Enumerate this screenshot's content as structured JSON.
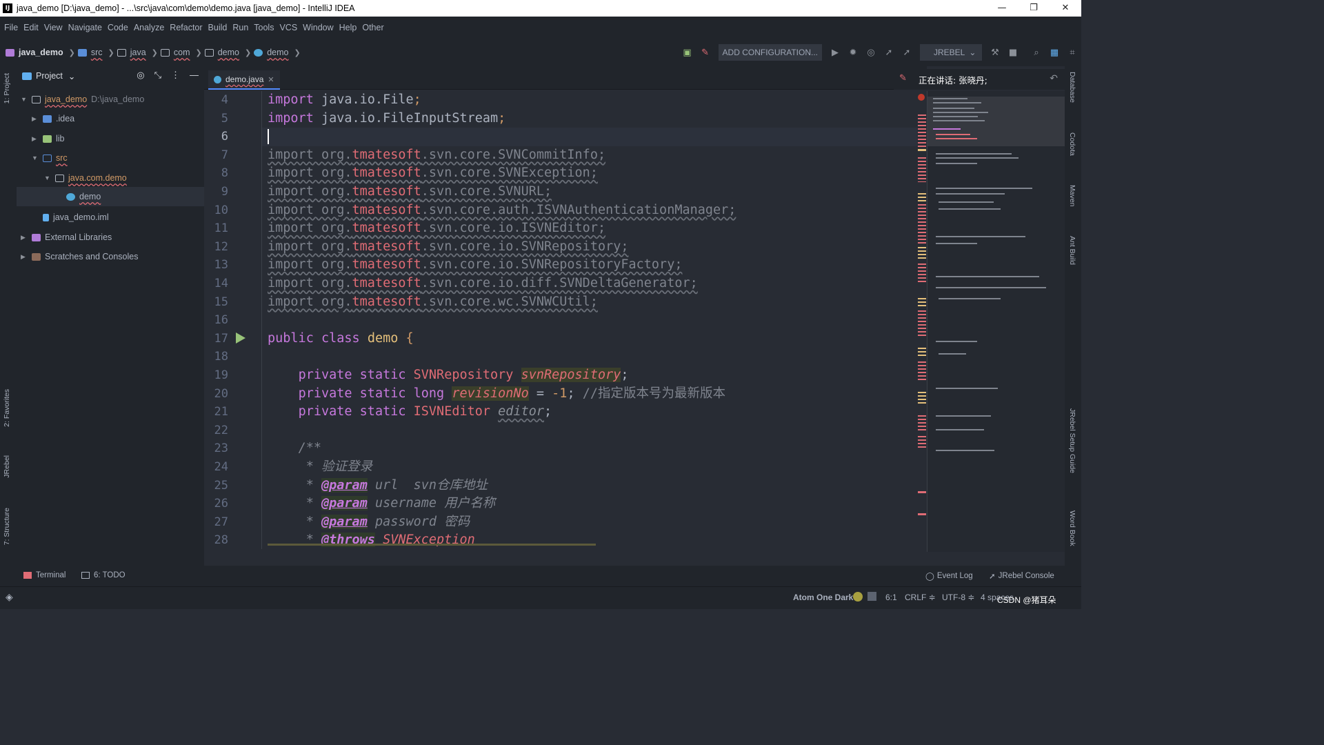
{
  "window": {
    "title": "java_demo [D:\\java_demo] - ...\\src\\java\\com\\demo\\demo.java [java_demo] - IntelliJ IDEA",
    "minimize": "—",
    "maximize": "❐",
    "close": "✕"
  },
  "menu": [
    "File",
    "Edit",
    "View",
    "Navigate",
    "Code",
    "Analyze",
    "Refactor",
    "Build",
    "Run",
    "Tools",
    "VCS",
    "Window",
    "Help",
    "Other"
  ],
  "breadcrumbs": [
    "java_demo",
    "src",
    "java",
    "com",
    "demo",
    "demo"
  ],
  "toolbar": {
    "add_configuration": "ADD CONFIGURATION...",
    "jrebel": "JREBEL"
  },
  "left_tabs": [
    "1: Project",
    "2: Favorites",
    "JRebel",
    "7: Structure"
  ],
  "project": {
    "header": "Project",
    "tree": [
      {
        "label": "java_demo",
        "hint": "D:\\java_demo"
      },
      {
        "label": ".idea"
      },
      {
        "label": "lib"
      },
      {
        "label": "src"
      },
      {
        "label": "java.com.demo"
      },
      {
        "label": "demo"
      },
      {
        "label": "java_demo.iml"
      },
      {
        "label": "External Libraries"
      },
      {
        "label": "Scratches and Consoles"
      }
    ]
  },
  "editor": {
    "tab": "demo.java",
    "line_numbers": [
      "4",
      "5",
      "6",
      "7",
      "8",
      "9",
      "10",
      "11",
      "12",
      "13",
      "14",
      "15",
      "16",
      "17",
      "18",
      "19",
      "20",
      "21",
      "22",
      "23",
      "24",
      "25",
      "26",
      "27",
      "28"
    ],
    "current_line": "6",
    "imports": [
      {
        "kw": "import",
        "pkg": "java.io.File",
        "end": ";"
      },
      {
        "kw": "import",
        "pkg": "java.io.FileInputStream",
        "end": ";"
      }
    ],
    "svn_imports": [
      {
        "pre": "import org.",
        "pkg": "tmatesoft",
        "post": ".svn.core.SVNCommitInfo;"
      },
      {
        "pre": "import org.",
        "pkg": "tmatesoft",
        "post": ".svn.core.SVNException;"
      },
      {
        "pre": "import org.",
        "pkg": "tmatesoft",
        "post": ".svn.core.SVNURL;"
      },
      {
        "pre": "import org.",
        "pkg": "tmatesoft",
        "post": ".svn.core.auth.ISVNAuthenticationManager;"
      },
      {
        "pre": "import org.",
        "pkg": "tmatesoft",
        "post": ".svn.core.io.ISVNEditor;"
      },
      {
        "pre": "import org.",
        "pkg": "tmatesoft",
        "post": ".svn.core.io.SVNRepository;"
      },
      {
        "pre": "import org.",
        "pkg": "tmatesoft",
        "post": ".svn.core.io.SVNRepositoryFactory;"
      },
      {
        "pre": "import org.",
        "pkg": "tmatesoft",
        "post": ".svn.core.io.diff.SVNDeltaGenerator;"
      },
      {
        "pre": "import org.",
        "pkg": "tmatesoft",
        "post": ".svn.core.wc.SVNWCUtil;"
      }
    ],
    "class_line": {
      "kw1": "public",
      "kw2": "class",
      "name": "demo",
      "brace": "{"
    },
    "field1": {
      "mods": "private static",
      "type": "SVNRepository",
      "name": "svnRepository",
      "end": ";"
    },
    "field2": {
      "mods": "private static",
      "type": "long",
      "name": "revisionNo",
      "rest": " = ",
      "num": "-1",
      "end": ";",
      "comment": "//指定版本号为最新版本"
    },
    "field3": {
      "mods": "private static",
      "type": "ISVNEditor",
      "name": "editor",
      "end": ";"
    },
    "doc": {
      "open": "/**",
      "l1": "* 验证登录",
      "p1_tag": "@param",
      "p1": "url  svn仓库地址",
      "p2_tag": "@param",
      "p2": "username 用户名称",
      "p3_tag": "@param",
      "p3": "password 密码",
      "t_tag": "@throws",
      "t": "SVNException"
    }
  },
  "notification": "正在讲话: 张晓丹;",
  "right_tabs": [
    "Database",
    "Codota",
    "Maven",
    "Ant Build",
    "JRebel Setup Guide",
    "Word Book"
  ],
  "bottom_tools": {
    "terminal": "Terminal",
    "todo": "6: TODO",
    "event_log": "Event Log",
    "jrebel_console": "JRebel Console"
  },
  "status": {
    "theme": "Atom One Dark",
    "position": "6:1",
    "line_sep": "CRLF ≑",
    "encoding": "UTF-8 ≑",
    "indent": "4 spaces",
    "watermark": "CSDN @猪耳朵"
  },
  "colors": {
    "background": "#282c34",
    "panel": "#21252b",
    "keyword": "#c678dd",
    "error": "#e06c75",
    "accent": "#528bff"
  }
}
